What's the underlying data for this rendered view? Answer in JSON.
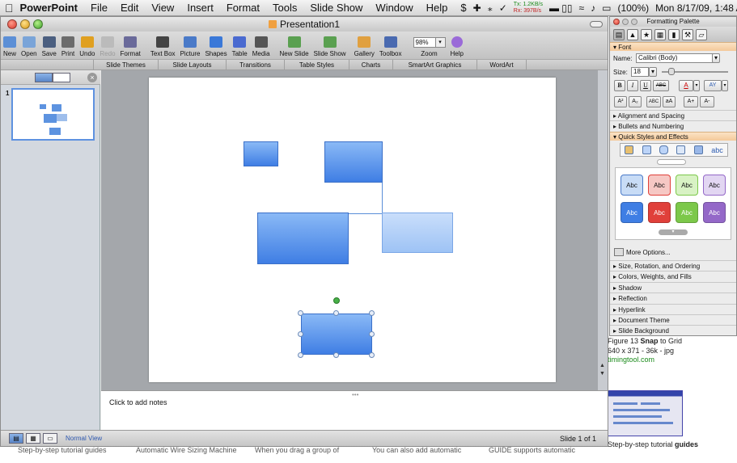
{
  "menubar": {
    "app_name": "PowerPoint",
    "items": [
      "File",
      "Edit",
      "View",
      "Insert",
      "Format",
      "Tools",
      "Slide Show",
      "Window",
      "Help"
    ],
    "script_icon": "dollar-script-icon",
    "net_tx": "Tx: 1.2KB/s",
    "net_rx": "Rx: 397B/s",
    "battery": "(100%)",
    "clock": "Mon 8/17/09, 1:48 AM"
  },
  "window": {
    "title": "Presentation1"
  },
  "toolbar": {
    "buttons": [
      {
        "label": "New",
        "icon": "new-doc-icon",
        "color": "#5c8fd6"
      },
      {
        "label": "Open",
        "icon": "open-folder-icon",
        "color": "#7aa4d8"
      },
      {
        "label": "Save",
        "icon": "save-disk-icon",
        "color": "#4b5f80"
      },
      {
        "label": "Print",
        "icon": "printer-icon",
        "color": "#6b6b6b"
      },
      {
        "label": "Undo",
        "icon": "undo-icon",
        "color": "#e0a020"
      },
      {
        "label": "Redo",
        "icon": "redo-icon",
        "color": "#bbbbbb"
      },
      {
        "label": "Format",
        "icon": "format-brush-icon",
        "color": "#6a6a9a"
      },
      {
        "label": "Text Box",
        "icon": "text-box-icon",
        "color": "#444444"
      },
      {
        "label": "Picture",
        "icon": "picture-icon",
        "color": "#4a7ac8"
      },
      {
        "label": "Shapes",
        "icon": "shapes-icon",
        "color": "#3a78d8"
      },
      {
        "label": "Table",
        "icon": "table-icon",
        "color": "#4a6ad0"
      },
      {
        "label": "Media",
        "icon": "media-icon",
        "color": "#555555"
      },
      {
        "label": "New Slide",
        "icon": "new-slide-icon",
        "color": "#5aa050"
      },
      {
        "label": "Slide Show",
        "icon": "slide-show-icon",
        "color": "#5aa050"
      },
      {
        "label": "Gallery",
        "icon": "gallery-icon",
        "color": "#e0a040"
      },
      {
        "label": "Toolbox",
        "icon": "toolbox-icon",
        "color": "#4a6ab0"
      }
    ],
    "zoom_value": "98%",
    "zoom_label": "Zoom",
    "help_label": "Help"
  },
  "ribbon_tabs": [
    "Slide Themes",
    "Slide Layouts",
    "Transitions",
    "Table Styles",
    "Charts",
    "SmartArt Graphics",
    "WordArt"
  ],
  "slide_panel": {
    "slide_number": "1"
  },
  "notes": {
    "placeholder": "Click to add notes"
  },
  "status": {
    "view_mode": "Normal View",
    "slide_position": "Slide 1 of 1"
  },
  "palette": {
    "title": "Formatting Palette",
    "font_section": "Font",
    "name_label": "Name:",
    "font_name": "Calibri (Body)",
    "size_label": "Size:",
    "font_size": "18",
    "style_buttons": [
      "B",
      "I",
      "U",
      "ABC",
      "A",
      "AY"
    ],
    "script_buttons": [
      "A²",
      "A₂",
      "ABC",
      "aA",
      "A+",
      "A-"
    ],
    "sections_before": [
      "Alignment and Spacing",
      "Bullets and Numbering"
    ],
    "open_section": "Quick Styles and Effects",
    "quick_style_text": "abc",
    "swatch_label": "Abc",
    "swatches_row1": [
      "#c8dcf6",
      "#f6c8c4",
      "#d8f2c4",
      "#e2d6f2"
    ],
    "swatches_row2": [
      "#3f7ee4",
      "#e0403a",
      "#7cc84a",
      "#9468c8"
    ],
    "more_options": "More Options...",
    "sections_after": [
      "Size, Rotation, and Ordering",
      "Colors, Weights, and Fills",
      "Shadow",
      "Reflection",
      "Hyperlink",
      "Document Theme",
      "Slide Background"
    ]
  },
  "background_web": {
    "caption_title_prefix": "Figure 13 ",
    "caption_title_bold": "Snap",
    "caption_title_suffix": " to Grid",
    "caption_meta": "640 x 371 - 36k - jpg",
    "caption_site": "timingtool.com",
    "bottom_caption_prefix": "Step-by-step tutorial ",
    "bottom_caption_bold": "guides",
    "bottom_fragments": [
      "Step-by-step tutorial guides",
      "Automatic Wire Sizing Machine",
      "When you drag a group of",
      "You can also add automatic",
      "GUIDE supports automatic"
    ]
  }
}
